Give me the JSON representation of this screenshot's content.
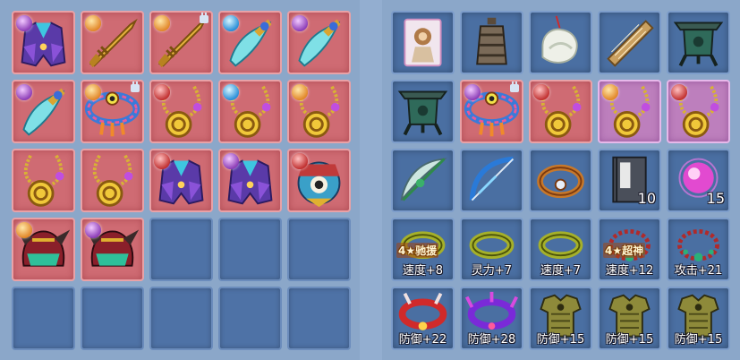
{
  "left_grid": {
    "rows": [
      [
        {
          "item": "robe-icon",
          "frame": "red",
          "badge": "purple"
        },
        {
          "item": "golden-sword-icon",
          "frame": "red",
          "badge": "orange"
        },
        {
          "item": "golden-sword-icon",
          "frame": "red",
          "badge": "orange",
          "locked": true
        },
        {
          "item": "jade-blade-icon",
          "frame": "red",
          "badge": "blue"
        },
        {
          "item": "jade-blade-icon",
          "frame": "red",
          "badge": "purple"
        }
      ],
      [
        {
          "item": "jade-blade-icon",
          "frame": "red",
          "badge": "purple"
        },
        {
          "item": "eye-circlet-icon",
          "frame": "red",
          "badge": "orange",
          "locked": true
        },
        {
          "item": "gold-amulet-icon",
          "frame": "red",
          "badge": "red"
        },
        {
          "item": "gold-amulet-icon",
          "frame": "red",
          "badge": "blue"
        },
        {
          "item": "gold-amulet-icon",
          "frame": "red",
          "badge": "orange"
        }
      ],
      [
        {
          "item": "gold-amulet-icon",
          "frame": "red"
        },
        {
          "item": "gold-amulet-icon",
          "frame": "red"
        },
        {
          "item": "robe-icon",
          "frame": "red",
          "badge": "red"
        },
        {
          "item": "robe-icon",
          "frame": "red",
          "badge": "purple"
        },
        {
          "item": "spirit-mask-icon",
          "frame": "red",
          "badge": "red"
        }
      ],
      [
        {
          "item": "horned-helmet-icon",
          "frame": "red",
          "badge": "orange"
        },
        {
          "item": "horned-helmet-icon",
          "frame": "red",
          "badge": "purple"
        },
        {
          "item": "",
          "frame": "empty"
        },
        {
          "item": "",
          "frame": "empty"
        },
        {
          "item": "",
          "frame": "empty"
        }
      ],
      [
        {
          "item": "",
          "frame": "empty"
        },
        {
          "item": "",
          "frame": "empty"
        },
        {
          "item": "",
          "frame": "empty"
        },
        {
          "item": "",
          "frame": "empty"
        },
        {
          "item": "",
          "frame": "empty"
        }
      ]
    ]
  },
  "right_grid": {
    "rows": [
      [
        {
          "item": "monkey-card-icon",
          "frame": "blue"
        },
        {
          "item": "bronze-bell-icon",
          "frame": "blue"
        },
        {
          "item": "jade-phoenix-icon",
          "frame": "blue"
        },
        {
          "item": "zither-icon",
          "frame": "blue"
        },
        {
          "item": "bronze-cauldron-icon",
          "frame": "blue"
        }
      ],
      [
        {
          "item": "bronze-cauldron-icon",
          "frame": "blue"
        },
        {
          "item": "eye-circlet-icon",
          "frame": "red",
          "badge": "purple",
          "locked": true
        },
        {
          "item": "gold-amulet-icon",
          "frame": "red",
          "badge": "red"
        },
        {
          "item": "gold-amulet-icon",
          "frame": "purple",
          "badge": "orange"
        },
        {
          "item": "gold-amulet-icon",
          "frame": "purple",
          "badge": "red"
        }
      ],
      [
        {
          "item": "jade-bow-icon",
          "frame": "blue"
        },
        {
          "item": "blue-bow-icon",
          "frame": "blue"
        },
        {
          "item": "gem-bracelet-icon",
          "frame": "blue"
        },
        {
          "item": "book-icon",
          "frame": "blue",
          "count": "10"
        },
        {
          "item": "pink-orb-icon",
          "frame": "blue",
          "count": "15"
        }
      ],
      [
        {
          "item": "jade-ring-icon",
          "frame": "blue",
          "tag": "4★驰援",
          "stat": "速度+8"
        },
        {
          "item": "jade-ring-icon",
          "frame": "blue",
          "stat": "灵力+7"
        },
        {
          "item": "jade-ring-icon",
          "frame": "blue",
          "stat": "速度+7"
        },
        {
          "item": "bead-necklace-icon",
          "frame": "blue",
          "tag": "4★超神",
          "stat": "速度+12"
        },
        {
          "item": "bead-necklace-icon",
          "frame": "blue",
          "stat": "攻击+21"
        }
      ],
      [
        {
          "item": "red-collar-icon",
          "frame": "blue",
          "stat": "防御+22"
        },
        {
          "item": "purple-collar-icon",
          "frame": "blue",
          "stat": "防御+28"
        },
        {
          "item": "armor-icon",
          "frame": "blue",
          "stat": "防御+15"
        },
        {
          "item": "armor-icon",
          "frame": "blue",
          "stat": "防御+15"
        },
        {
          "item": "armor-icon",
          "frame": "blue",
          "stat": "防御+15"
        }
      ]
    ]
  },
  "colors": {
    "red_frame": "#cf6b73",
    "blue_frame": "#4a6fa2",
    "purple_frame": "#bd7fbd",
    "empty_slot": "#4e72a6"
  }
}
